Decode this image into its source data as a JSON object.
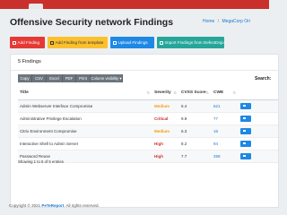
{
  "header": {
    "title": "Offensive Security network Findings",
    "breadcrumb": [
      "Home",
      "MegaCorp Ori"
    ],
    "colors": {
      "topbar": "#c9302c",
      "link": "#1976d2"
    }
  },
  "actions": {
    "add_finding": "Add Finding",
    "add_from_template": "Add Finding from template",
    "upload_findings": "Upload Findings",
    "import_findings": "Import Findings from DefectDojo",
    "colors": {
      "add_finding": "#e53935",
      "add_from_template": "#fbc02d",
      "upload_findings": "#1e88e5",
      "import_findings": "#26a69a"
    }
  },
  "card": {
    "title": "5 Findings",
    "exports": [
      "Copy",
      "CSV",
      "Excel",
      "PDF",
      "Print",
      "Column visibility"
    ],
    "search_label": "Search:",
    "columns": [
      "Title",
      "Severity",
      "CVSS Score",
      "CWE"
    ],
    "rows": [
      {
        "title": "Admin Webserver Interface Compromise",
        "severity": "Medium",
        "cvss": "6.4",
        "cwe": "521"
      },
      {
        "title": "Administrative Privilege Escalation",
        "severity": "Critical",
        "cvss": "9.9",
        "cwe": "77"
      },
      {
        "title": "Citrix Environment Compromise",
        "severity": "Medium",
        "cvss": "6.3",
        "cwe": "16"
      },
      {
        "title": "Interactive Shell to Admin Server",
        "severity": "High",
        "cvss": "8.2",
        "cwe": "94"
      },
      {
        "title": "Password Reuse",
        "severity": "High",
        "cvss": "7.7",
        "cwe": "269"
      }
    ],
    "severity_colors": {
      "Medium": "#f39c12",
      "Critical": "#c62828",
      "High": "#d32f2f"
    },
    "showing_text": "Showing 1 to 5 of 5 entries"
  },
  "footer": {
    "copyright": "Copyright © 2021",
    "brand": "PeTeReport",
    "rights": ". All rights reserved."
  }
}
